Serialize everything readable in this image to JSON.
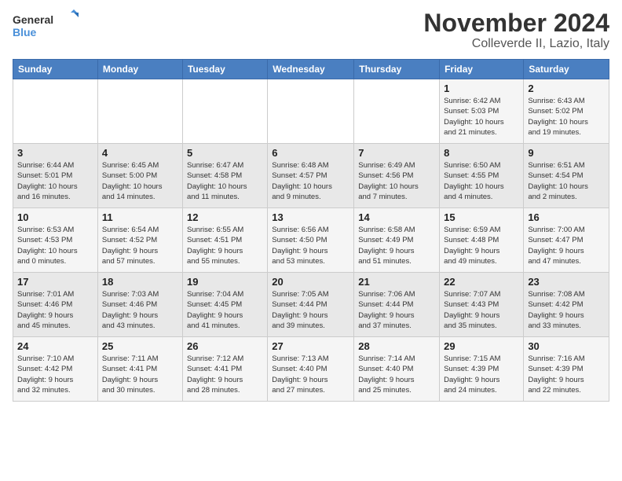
{
  "header": {
    "logo_line1": "General",
    "logo_line2": "Blue",
    "month": "November 2024",
    "location": "Colleverde II, Lazio, Italy"
  },
  "weekdays": [
    "Sunday",
    "Monday",
    "Tuesday",
    "Wednesday",
    "Thursday",
    "Friday",
    "Saturday"
  ],
  "weeks": [
    [
      {
        "day": "",
        "info": ""
      },
      {
        "day": "",
        "info": ""
      },
      {
        "day": "",
        "info": ""
      },
      {
        "day": "",
        "info": ""
      },
      {
        "day": "",
        "info": ""
      },
      {
        "day": "1",
        "info": "Sunrise: 6:42 AM\nSunset: 5:03 PM\nDaylight: 10 hours\nand 21 minutes."
      },
      {
        "day": "2",
        "info": "Sunrise: 6:43 AM\nSunset: 5:02 PM\nDaylight: 10 hours\nand 19 minutes."
      }
    ],
    [
      {
        "day": "3",
        "info": "Sunrise: 6:44 AM\nSunset: 5:01 PM\nDaylight: 10 hours\nand 16 minutes."
      },
      {
        "day": "4",
        "info": "Sunrise: 6:45 AM\nSunset: 5:00 PM\nDaylight: 10 hours\nand 14 minutes."
      },
      {
        "day": "5",
        "info": "Sunrise: 6:47 AM\nSunset: 4:58 PM\nDaylight: 10 hours\nand 11 minutes."
      },
      {
        "day": "6",
        "info": "Sunrise: 6:48 AM\nSunset: 4:57 PM\nDaylight: 10 hours\nand 9 minutes."
      },
      {
        "day": "7",
        "info": "Sunrise: 6:49 AM\nSunset: 4:56 PM\nDaylight: 10 hours\nand 7 minutes."
      },
      {
        "day": "8",
        "info": "Sunrise: 6:50 AM\nSunset: 4:55 PM\nDaylight: 10 hours\nand 4 minutes."
      },
      {
        "day": "9",
        "info": "Sunrise: 6:51 AM\nSunset: 4:54 PM\nDaylight: 10 hours\nand 2 minutes."
      }
    ],
    [
      {
        "day": "10",
        "info": "Sunrise: 6:53 AM\nSunset: 4:53 PM\nDaylight: 10 hours\nand 0 minutes."
      },
      {
        "day": "11",
        "info": "Sunrise: 6:54 AM\nSunset: 4:52 PM\nDaylight: 9 hours\nand 57 minutes."
      },
      {
        "day": "12",
        "info": "Sunrise: 6:55 AM\nSunset: 4:51 PM\nDaylight: 9 hours\nand 55 minutes."
      },
      {
        "day": "13",
        "info": "Sunrise: 6:56 AM\nSunset: 4:50 PM\nDaylight: 9 hours\nand 53 minutes."
      },
      {
        "day": "14",
        "info": "Sunrise: 6:58 AM\nSunset: 4:49 PM\nDaylight: 9 hours\nand 51 minutes."
      },
      {
        "day": "15",
        "info": "Sunrise: 6:59 AM\nSunset: 4:48 PM\nDaylight: 9 hours\nand 49 minutes."
      },
      {
        "day": "16",
        "info": "Sunrise: 7:00 AM\nSunset: 4:47 PM\nDaylight: 9 hours\nand 47 minutes."
      }
    ],
    [
      {
        "day": "17",
        "info": "Sunrise: 7:01 AM\nSunset: 4:46 PM\nDaylight: 9 hours\nand 45 minutes."
      },
      {
        "day": "18",
        "info": "Sunrise: 7:03 AM\nSunset: 4:46 PM\nDaylight: 9 hours\nand 43 minutes."
      },
      {
        "day": "19",
        "info": "Sunrise: 7:04 AM\nSunset: 4:45 PM\nDaylight: 9 hours\nand 41 minutes."
      },
      {
        "day": "20",
        "info": "Sunrise: 7:05 AM\nSunset: 4:44 PM\nDaylight: 9 hours\nand 39 minutes."
      },
      {
        "day": "21",
        "info": "Sunrise: 7:06 AM\nSunset: 4:44 PM\nDaylight: 9 hours\nand 37 minutes."
      },
      {
        "day": "22",
        "info": "Sunrise: 7:07 AM\nSunset: 4:43 PM\nDaylight: 9 hours\nand 35 minutes."
      },
      {
        "day": "23",
        "info": "Sunrise: 7:08 AM\nSunset: 4:42 PM\nDaylight: 9 hours\nand 33 minutes."
      }
    ],
    [
      {
        "day": "24",
        "info": "Sunrise: 7:10 AM\nSunset: 4:42 PM\nDaylight: 9 hours\nand 32 minutes."
      },
      {
        "day": "25",
        "info": "Sunrise: 7:11 AM\nSunset: 4:41 PM\nDaylight: 9 hours\nand 30 minutes."
      },
      {
        "day": "26",
        "info": "Sunrise: 7:12 AM\nSunset: 4:41 PM\nDaylight: 9 hours\nand 28 minutes."
      },
      {
        "day": "27",
        "info": "Sunrise: 7:13 AM\nSunset: 4:40 PM\nDaylight: 9 hours\nand 27 minutes."
      },
      {
        "day": "28",
        "info": "Sunrise: 7:14 AM\nSunset: 4:40 PM\nDaylight: 9 hours\nand 25 minutes."
      },
      {
        "day": "29",
        "info": "Sunrise: 7:15 AM\nSunset: 4:39 PM\nDaylight: 9 hours\nand 24 minutes."
      },
      {
        "day": "30",
        "info": "Sunrise: 7:16 AM\nSunset: 4:39 PM\nDaylight: 9 hours\nand 22 minutes."
      }
    ]
  ]
}
